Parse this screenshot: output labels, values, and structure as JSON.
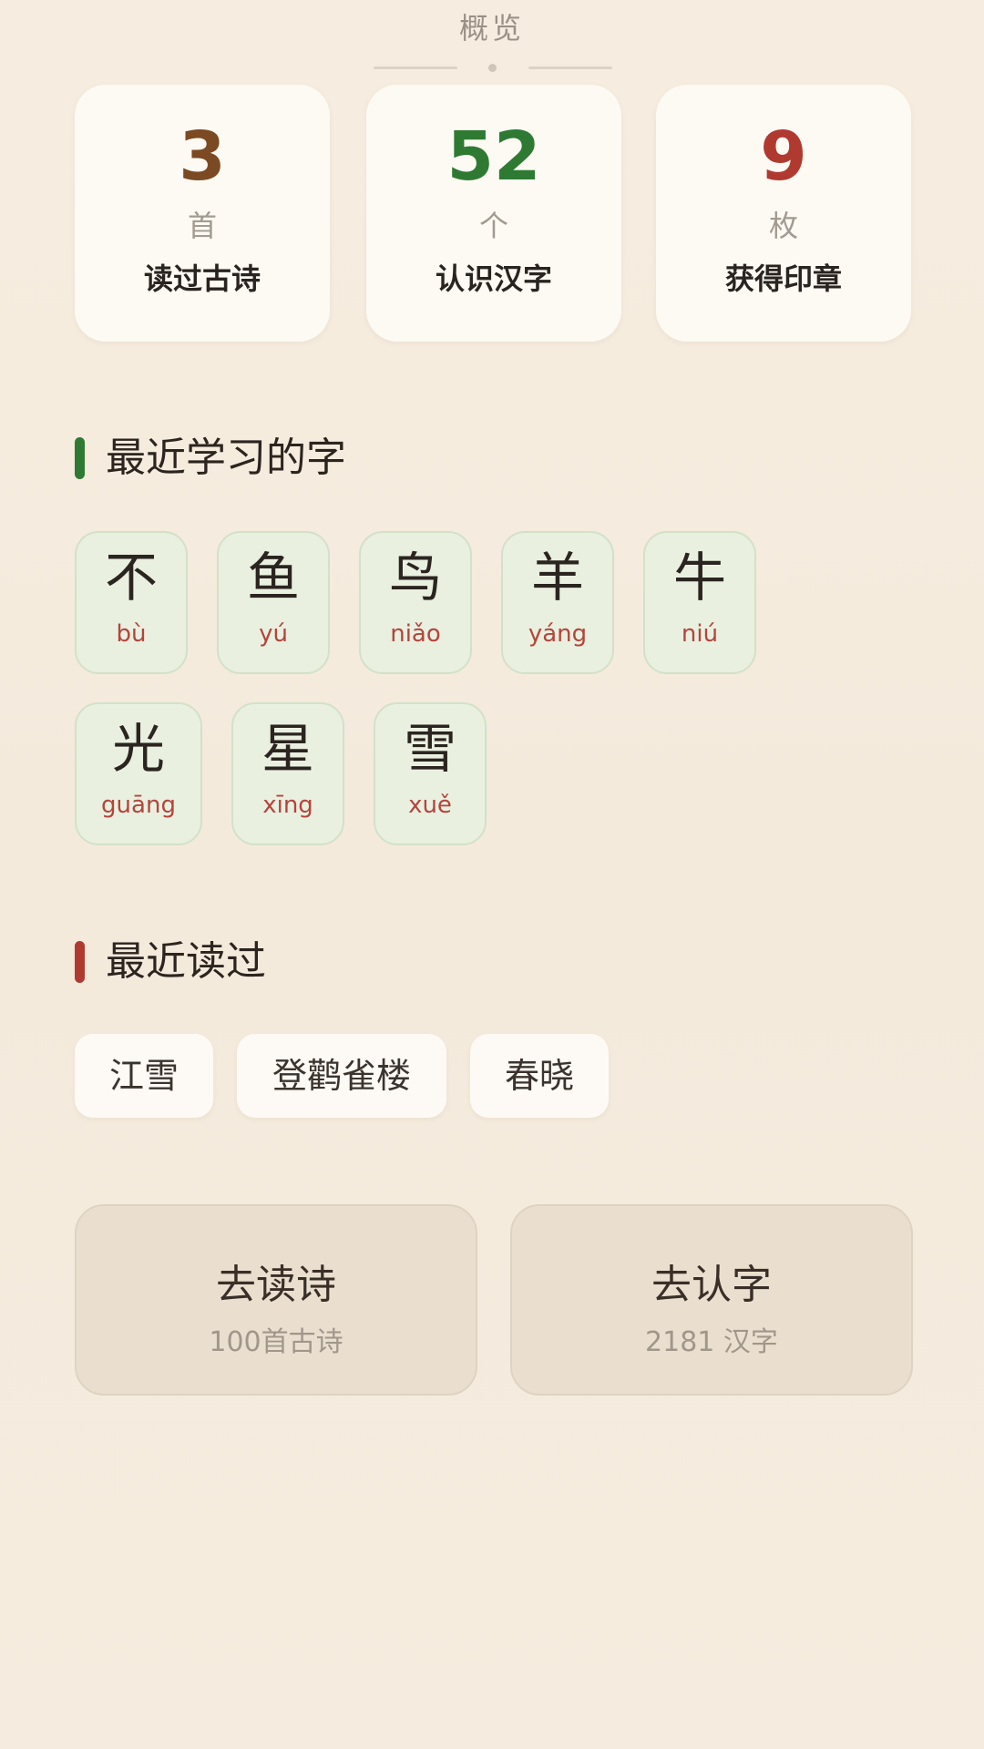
{
  "header": {
    "title": "概览"
  },
  "stats": [
    {
      "value": "3",
      "unit": "首",
      "label": "读过古诗",
      "color": "#7b4a22"
    },
    {
      "value": "52",
      "unit": "个",
      "label": "认识汉字",
      "color": "#2f7a33"
    },
    {
      "value": "9",
      "unit": "枚",
      "label": "获得印章",
      "color": "#b03a30"
    }
  ],
  "recent_chars": {
    "title": "最近学习的字",
    "accent": "#2f7a33",
    "items": [
      {
        "char": "不",
        "pinyin": "bù"
      },
      {
        "char": "鱼",
        "pinyin": "yú"
      },
      {
        "char": "鸟",
        "pinyin": "niǎo"
      },
      {
        "char": "羊",
        "pinyin": "yáng"
      },
      {
        "char": "牛",
        "pinyin": "niú"
      },
      {
        "char": "光",
        "pinyin": "guāng"
      },
      {
        "char": "星",
        "pinyin": "xīng"
      },
      {
        "char": "雪",
        "pinyin": "xuě"
      }
    ]
  },
  "recent_poems": {
    "title": "最近读过",
    "accent": "#b03a30",
    "items": [
      "江雪",
      "登鹳雀楼",
      "春晓"
    ]
  },
  "actions": [
    {
      "title": "去读诗",
      "subtitle": "100首古诗"
    },
    {
      "title": "去认字",
      "subtitle": "2181 汉字"
    }
  ]
}
